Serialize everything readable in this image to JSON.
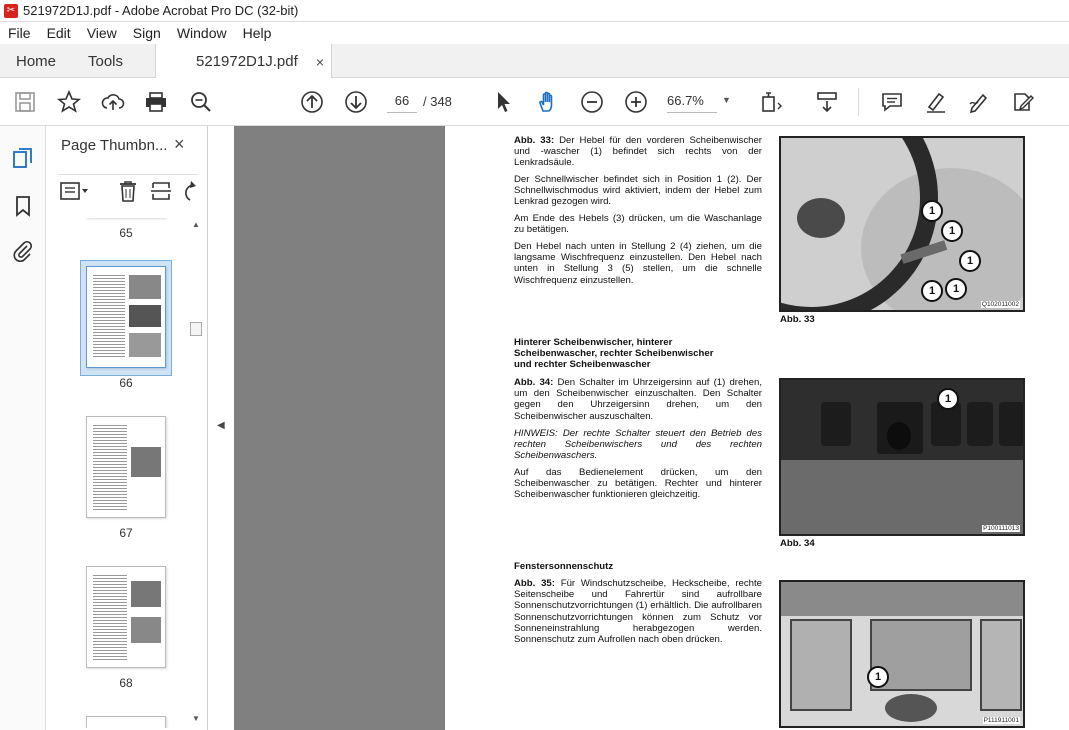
{
  "window": {
    "title": "521972D1J.pdf - Adobe Acrobat Pro DC (32-bit)"
  },
  "menu": [
    "File",
    "Edit",
    "View",
    "Sign",
    "Window",
    "Help"
  ],
  "tabs": {
    "home": "Home",
    "tools": "Tools",
    "document": "521972D1J.pdf",
    "close_glyph": "×"
  },
  "toolbar": {
    "page_current": "66",
    "page_total": "/ 348",
    "zoom": "66.7%",
    "icons": [
      "save-icon",
      "bookmark-star-icon",
      "upload-icon",
      "print-icon",
      "zoom-search-icon",
      "page-up-icon",
      "page-down-icon",
      "select-cursor-icon",
      "hand-icon",
      "zoom-out-icon",
      "zoom-in-icon",
      "page-fit-icon",
      "scroll-mode-icon",
      "comment-icon",
      "highlight-icon",
      "sign-icon",
      "fill-sign-icon"
    ]
  },
  "thumbnail_panel": {
    "title": "Page Thumbn...",
    "close_glyph": "×",
    "pages": [
      "65",
      "66",
      "67",
      "68"
    ],
    "selected_page": "66"
  },
  "document": {
    "abb33": {
      "para1_label": "Abb. 33:",
      "para1": "Der Hebel für den vorderen Scheibenwischer und -wascher (1) befindet sich rechts von der Lenkradsäule.",
      "para2": "Der Schnellwischer befindet sich in Position 1 (2). Der Schnellwischmodus wird aktiviert, indem der Hebel zum Lenkrad gezogen wird.",
      "para3": "Am Ende des Hebels (3) drücken, um die Waschanlage zu betätigen.",
      "para4": "Den Hebel nach unten in Stellung 2 (4) ziehen, um die langsame Wischfrequenz einzustellen. Den Hebel nach unten in Stellung 3 (5) stellen, um die schnelle Wischfrequenz einzustellen.",
      "photo_code": "Q102011002",
      "caption": "Abb. 33"
    },
    "section2": {
      "heading_l1": "Hinterer Scheibenwischer, hinterer",
      "heading_l2": "Scheibenwascher, rechter Scheibenwischer",
      "heading_l3": "und rechter Scheibenwascher",
      "para1_label": "Abb. 34:",
      "para1": "Den Schalter im Uhrzeigersinn auf (1) drehen, um den Scheibenwischer einzuschalten. Den Schalter gegen den Uhrzeigersinn drehen, um den Scheibenwischer auszuschalten.",
      "hinweis": "HINWEIS: Der rechte Schalter steuert den Betrieb des rechten Scheibenwischers und des rechten Scheibenwaschers.",
      "para2": "Auf das Bedienelement drücken, um den Scheibenwascher zu betätigen. Rechter und hinterer Scheibenwascher funktionieren gleichzeitig.",
      "photo_code": "P100111013",
      "caption": "Abb. 34"
    },
    "section3": {
      "heading": "Fenstersonnenschutz",
      "para1_label": "Abb. 35:",
      "para1": "Für Windschutzscheibe, Heckscheibe, rechte Seitenscheibe und Fahrertür sind aufrollbare Sonnenschutzvorrichtungen (1) erhältlich. Die aufrollbaren Sonnenschutzvorrichtungen können zum Schutz vor Sonneneinstrahlung herabgezogen werden. Sonnenschutz zum Aufrollen nach oben drücken.",
      "photo_code": "P111911001"
    },
    "callout_label": "1"
  }
}
